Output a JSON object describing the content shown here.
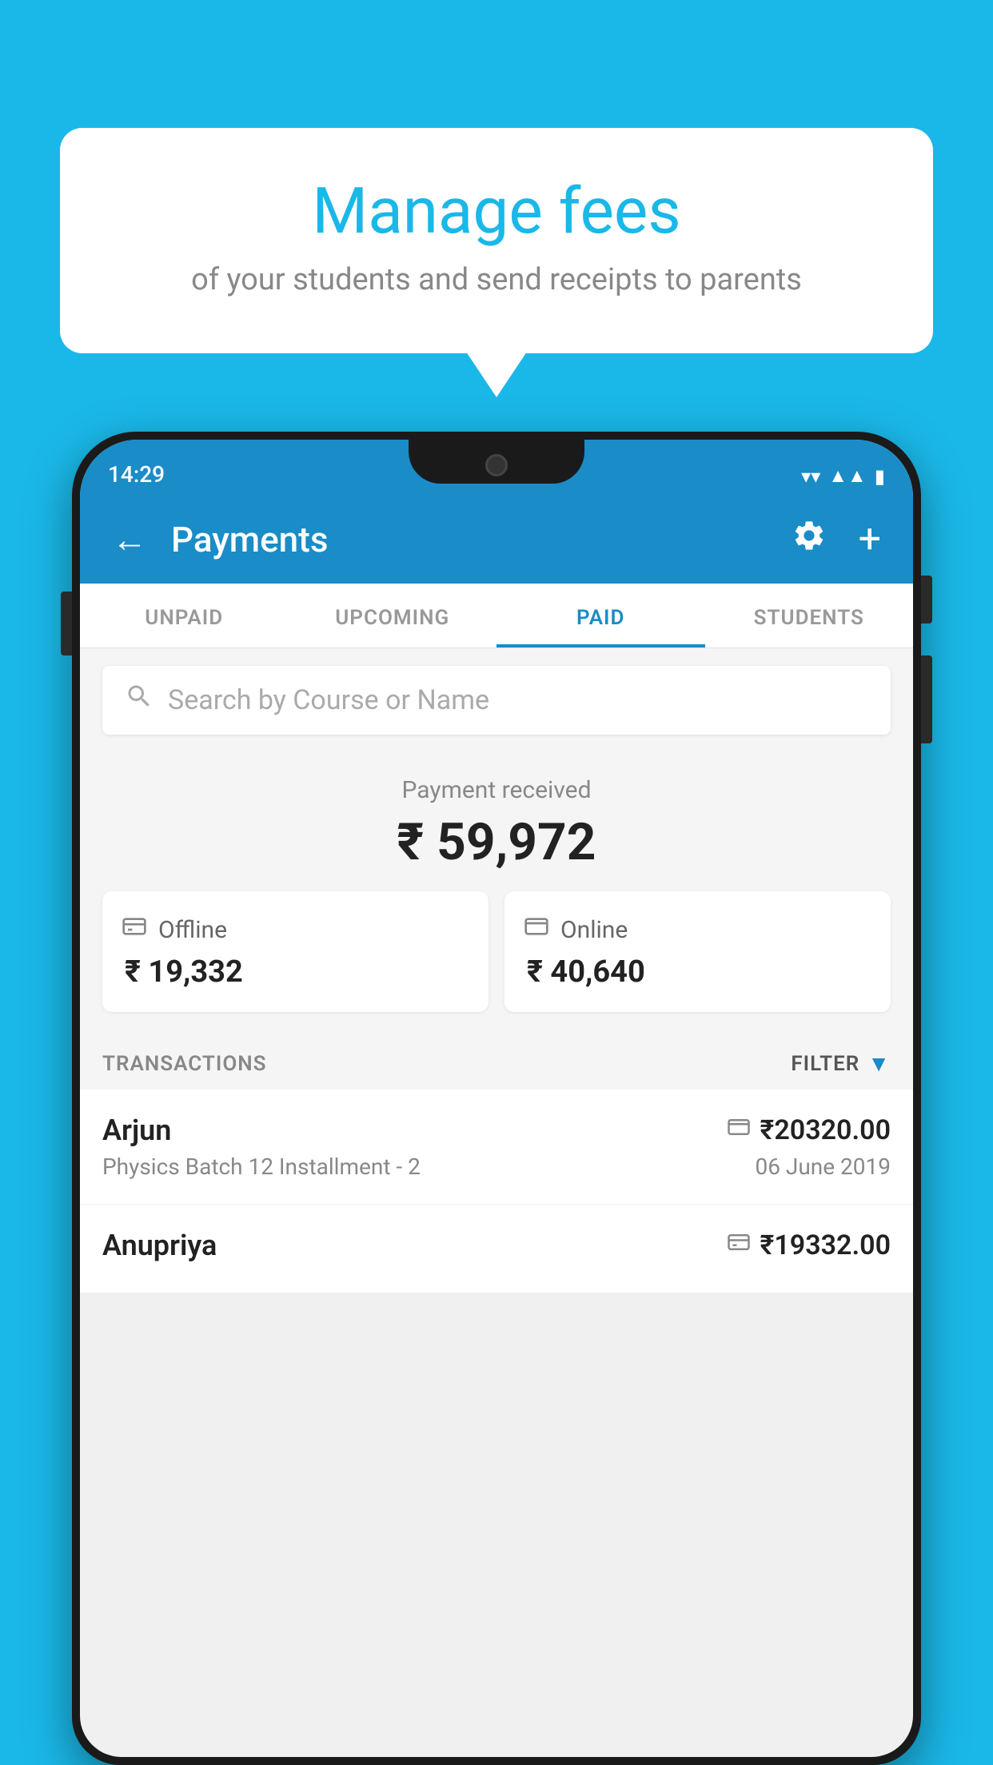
{
  "background_color": "#1ab8e8",
  "bubble": {
    "title": "Manage fees",
    "subtitle": "of your students and send receipts to parents"
  },
  "status_bar": {
    "time": "14:29",
    "wifi_icon": "▲",
    "signal_icon": "▲",
    "battery_icon": "▮"
  },
  "header": {
    "back_icon": "←",
    "title": "Payments",
    "gear_icon": "⚙",
    "plus_icon": "+"
  },
  "tabs": [
    {
      "label": "UNPAID",
      "active": false
    },
    {
      "label": "UPCOMING",
      "active": false
    },
    {
      "label": "PAID",
      "active": true
    },
    {
      "label": "STUDENTS",
      "active": false
    }
  ],
  "search": {
    "placeholder": "Search by Course or Name",
    "icon": "🔍"
  },
  "payment_summary": {
    "received_label": "Payment received",
    "total_amount": "₹ 59,972",
    "offline": {
      "label": "Offline",
      "amount": "₹ 19,332"
    },
    "online": {
      "label": "Online",
      "amount": "₹ 40,640"
    }
  },
  "transactions": {
    "section_label": "TRANSACTIONS",
    "filter_label": "FILTER",
    "rows": [
      {
        "name": "Arjun",
        "course": "Physics Batch 12 Installment - 2",
        "amount": "₹20320.00",
        "date": "06 June 2019",
        "type": "online"
      },
      {
        "name": "Anupriya",
        "course": "",
        "amount": "₹19332.00",
        "date": "",
        "type": "offline"
      }
    ]
  }
}
